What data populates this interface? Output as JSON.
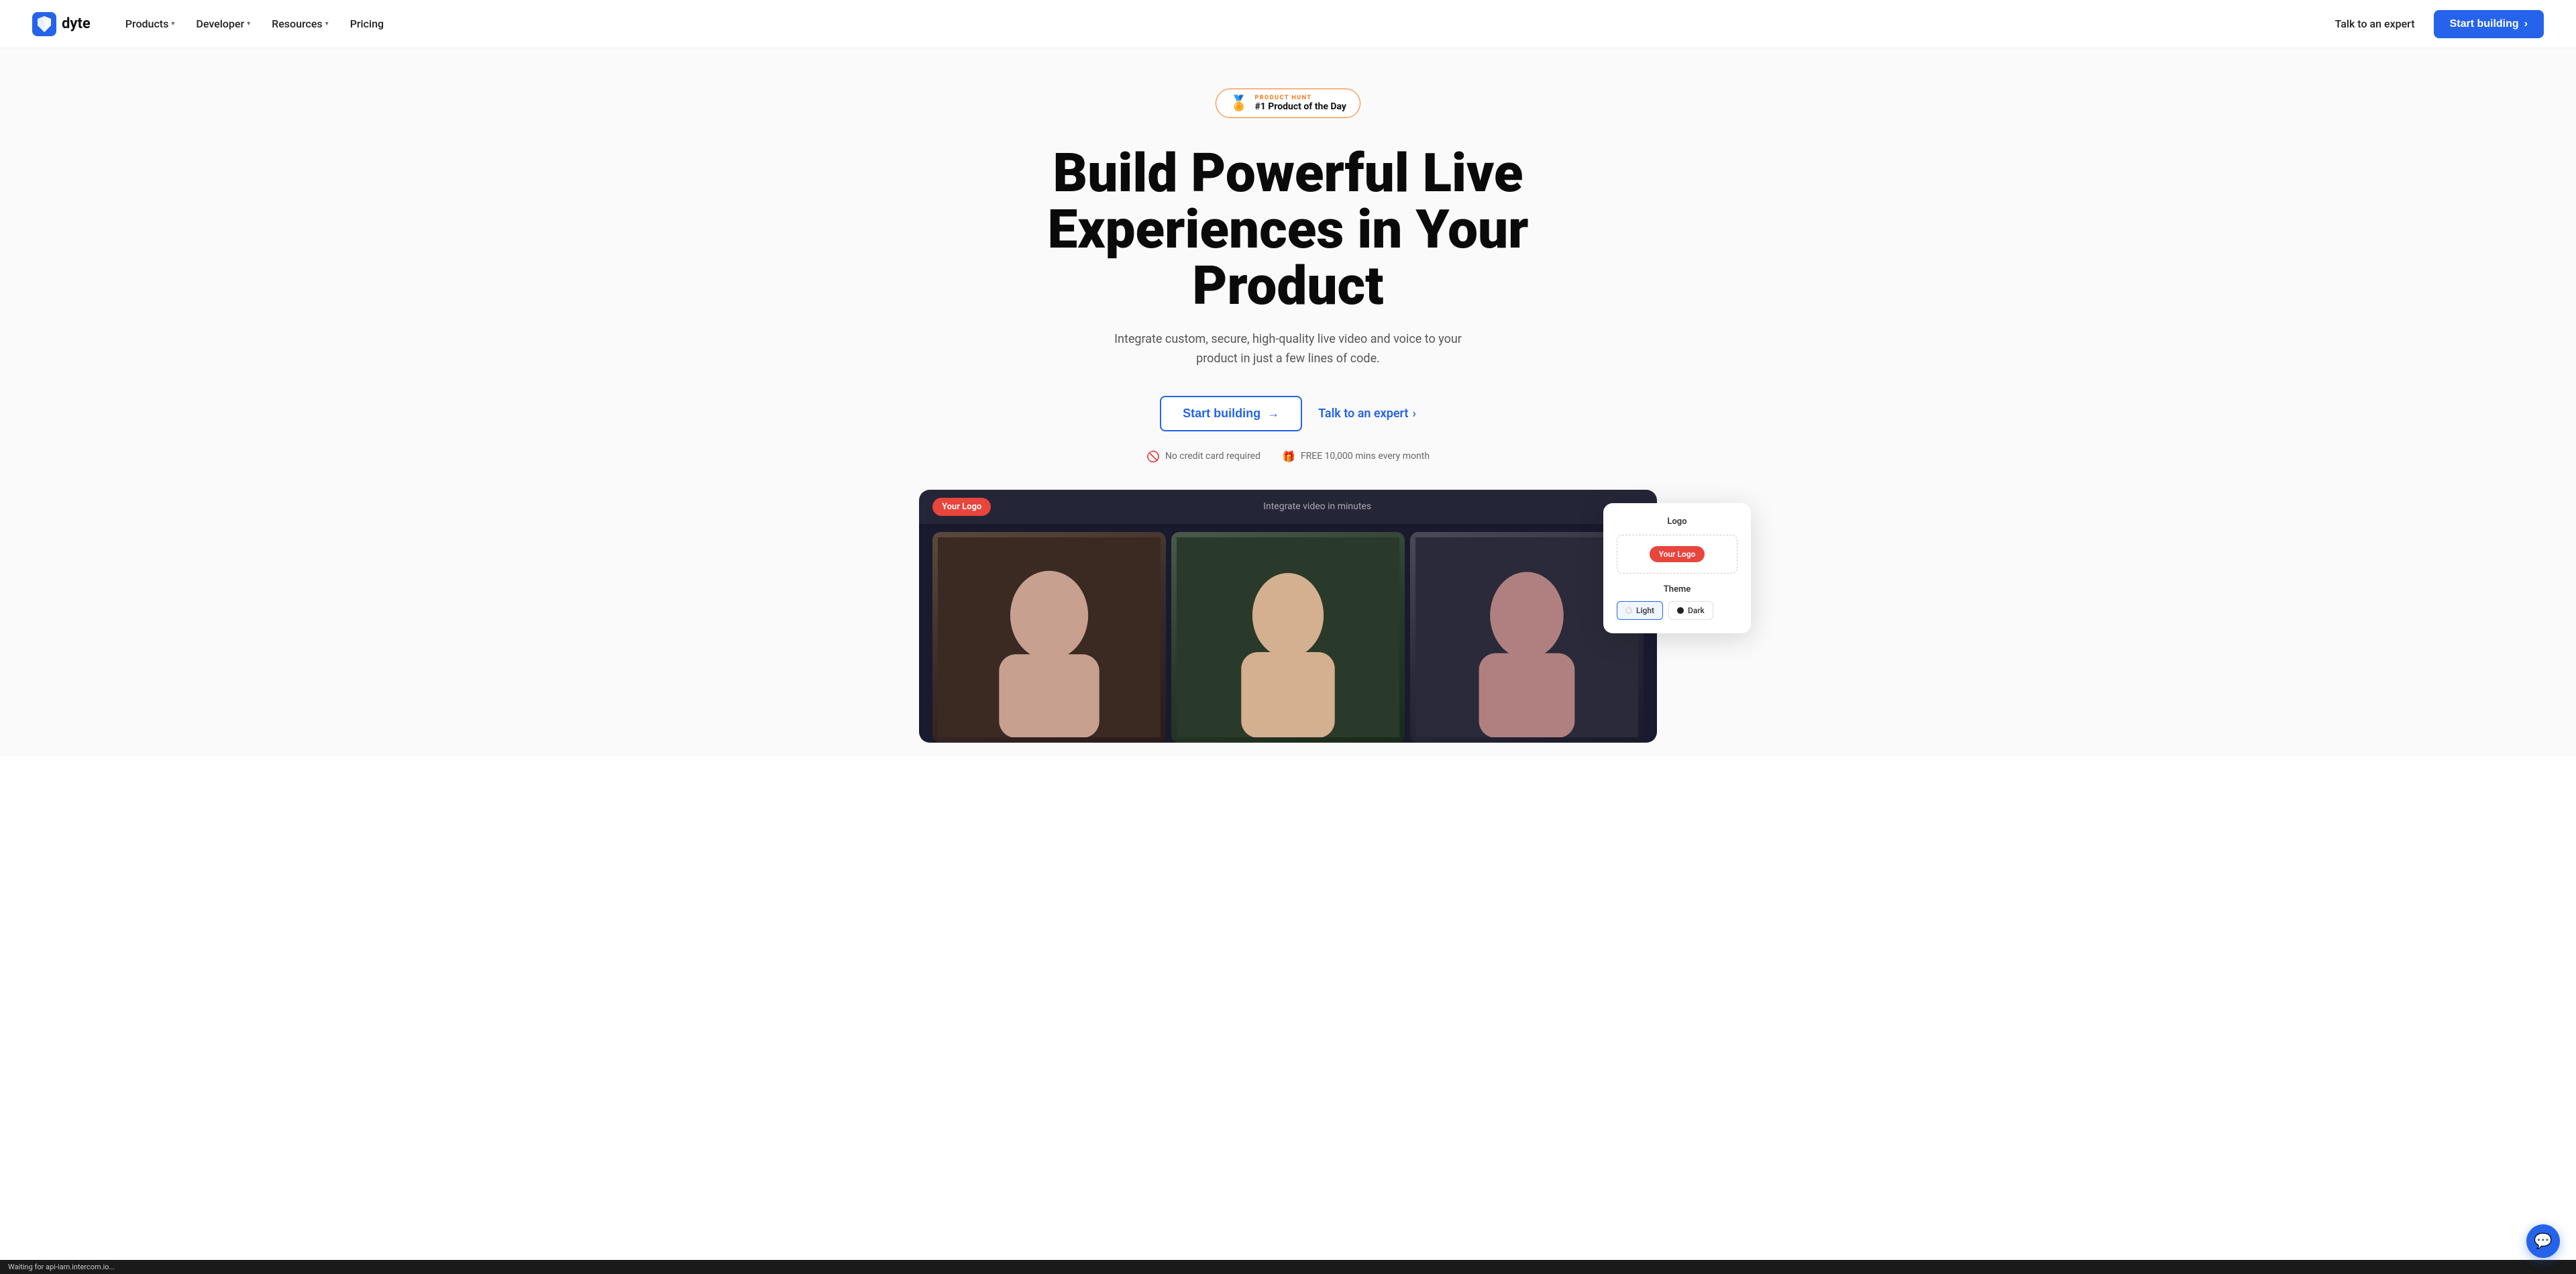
{
  "logo": {
    "name": "dyte",
    "icon_alt": "dyte logo"
  },
  "nav": {
    "items": [
      {
        "label": "Products",
        "has_dropdown": true
      },
      {
        "label": "Developer",
        "has_dropdown": true
      },
      {
        "label": "Resources",
        "has_dropdown": true
      },
      {
        "label": "Pricing",
        "has_dropdown": false
      }
    ],
    "cta_talk": "Talk to an expert",
    "cta_start": "Start building"
  },
  "hero": {
    "badge": {
      "label": "PRODUCT HUNT",
      "value": "#1 Product of the Day"
    },
    "title_line1": "Build Powerful Live",
    "title_line2": "Experiences in Your Product",
    "subtitle": "Integrate custom, secure, high-quality live video and voice to your product in just a few lines of code.",
    "cta_start": "Start building",
    "cta_talk": "Talk to an expert",
    "perk1": "No credit card required",
    "perk2": "FREE 10,000 mins every month"
  },
  "demo": {
    "logo_pill": "Your Logo",
    "center_text": "Integrate video in minutes"
  },
  "customizer": {
    "logo_section": "Logo",
    "logo_preview": "Your Logo",
    "theme_section": "Theme",
    "theme_light": "Light",
    "theme_dark": "Dark"
  },
  "status_bar": {
    "text": "Waiting for api-iam.intercom.io..."
  },
  "colors": {
    "accent": "#2563eb",
    "cta_bg": "#2563eb",
    "badge_border": "#f97316",
    "logo_pill": "#e8453c"
  }
}
